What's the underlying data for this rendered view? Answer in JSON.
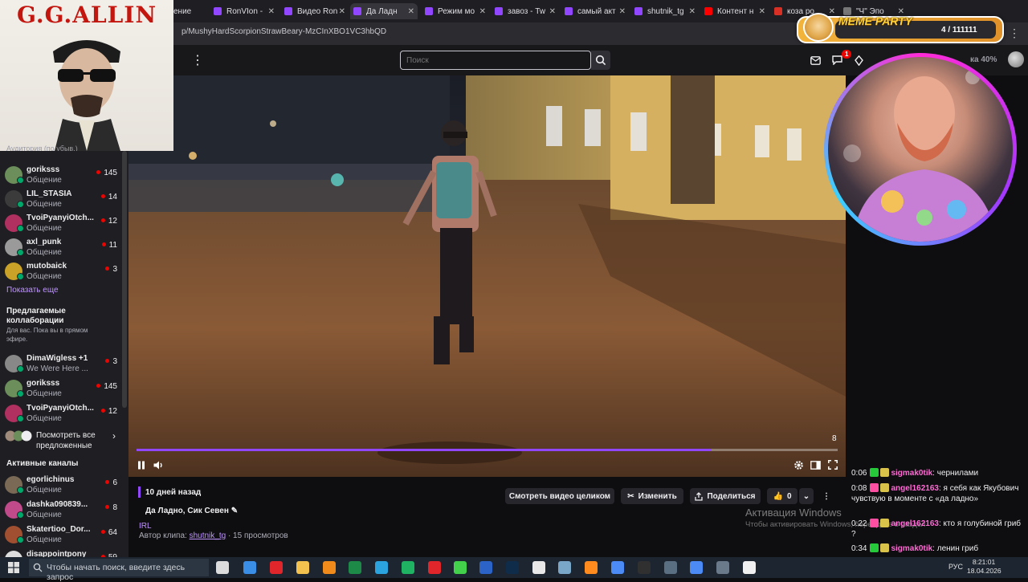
{
  "browser": {
    "tabs": [
      {
        "label": "ение",
        "color": "#9147ff"
      },
      {
        "label": "RonVIon -",
        "color": "#9147ff"
      },
      {
        "label": "Видео Ron",
        "color": "#9147ff"
      },
      {
        "label": "Да Ладн",
        "color": "#9147ff",
        "active": true
      },
      {
        "label": "Режим мо",
        "color": "#9147ff"
      },
      {
        "label": "завоз - Tw",
        "color": "#9147ff"
      },
      {
        "label": "самый акт",
        "color": "#9147ff"
      },
      {
        "label": "shutnik_tg",
        "color": "#9147ff"
      },
      {
        "label": "Контент н",
        "color": "#ff0000"
      },
      {
        "label": "коза ро",
        "color": "#d93025"
      },
      {
        "label": "\"Ч\" Эпо",
        "color": "#777777"
      }
    ],
    "url": "p/MushyHardScorpionStrawBeary-MzCInXBO1VC3hbQD"
  },
  "topnav": {
    "search_placeholder": "Поиск",
    "notifications_count": "1",
    "bits_label": "ка 40%"
  },
  "left_cam": {
    "banner": "G.G.ALLIN",
    "underlay_text": "Аудитория (по убыв.)"
  },
  "sidebar": {
    "followed": [
      {
        "name": "goriksss",
        "category": "Общение",
        "viewers": "145",
        "avatar": "#6b8e5a"
      },
      {
        "name": "LIL_STASIA",
        "category": "Общение",
        "viewers": "14",
        "avatar": "#3b3b3b"
      },
      {
        "name": "TvoiPyanyiOtch...",
        "category": "Общение",
        "viewers": "12",
        "avatar": "#b03060"
      },
      {
        "name": "axl_punk",
        "category": "Общение",
        "viewers": "11",
        "avatar": "#9a9a9a"
      },
      {
        "name": "mutobaick",
        "category": "Общение",
        "viewers": "3",
        "avatar": "#c9a227"
      }
    ],
    "show_more": "Показать еще",
    "collab_title": "Предлагаемые коллаборации",
    "collab_sub": "Для вас. Пока вы в прямом эфире.",
    "collab": [
      {
        "name": "DimaWigless +1",
        "category": "We Were Here ...",
        "viewers": "3",
        "avatar": "#888888"
      },
      {
        "name": "goriksss",
        "category": "Общение",
        "viewers": "145",
        "avatar": "#6b8e5a"
      },
      {
        "name": "TvoiPyanyiOtch...",
        "category": "Общение",
        "viewers": "12",
        "avatar": "#b03060"
      }
    ],
    "see_all": "Посмотреть все предложенные",
    "active_title": "Активные каналы",
    "active": [
      {
        "name": "egorlichinus",
        "category": "Общение",
        "viewers": "6",
        "avatar": "#7a6a55"
      },
      {
        "name": "dashka090839...",
        "category": "Общение",
        "viewers": "8",
        "avatar": "#c04a8a"
      },
      {
        "name": "Skatertioo_Dor...",
        "category": "Общение",
        "viewers": "64",
        "avatar": "#a05030"
      },
      {
        "name": "disappointpony",
        "category": "",
        "viewers": "59",
        "avatar": "#dddddd"
      }
    ]
  },
  "player": {
    "progress": 0.82,
    "clip_counter": "8"
  },
  "clip": {
    "age": "10 дней назад",
    "title": "Да Ладно, Сик Севен",
    "category": "IRL",
    "author_prefix": "Автор клипа:",
    "author": "shutnik_tg",
    "views": "· 15 просмотров",
    "btn_full": "Смотреть видео целиком",
    "btn_edit": "Изменить",
    "btn_share": "Поделиться",
    "likes": "0"
  },
  "windows_activation": {
    "title": "Активация Windows",
    "subtitle": "Чтобы активировать Windows, перейдите в раздел"
  },
  "meme_party": {
    "title": "MEME PARTY",
    "count": "4 / 111111"
  },
  "chat": [
    {
      "time": "0:06",
      "user": "sigmak0tik",
      "user_color": "#ff6ad5",
      "badge": "#25c93a",
      "text": ": чернилами"
    },
    {
      "time": "0:08",
      "user": "angel162163",
      "user_color": "#ff6ad5",
      "badge": "#ff4fa3",
      "text": ": я себя как Якубович чувствую в моменте с «да ладно»"
    },
    {
      "time": "0:22",
      "user": "angel162163",
      "user_color": "#ff6ad5",
      "badge": "#ff4fa3",
      "text": ": кто я голубиной гриб ?"
    },
    {
      "time": "0:34",
      "user": "sigmak0tik",
      "user_color": "#ff6ad5",
      "badge": "#25c93a",
      "text": ": ленин гриб"
    }
  ],
  "taskbar": {
    "search_placeholder": "Чтобы начать поиск, введите здесь запрос",
    "lang": "РУС",
    "time": "8:21:01",
    "date": "18.04.2026"
  }
}
